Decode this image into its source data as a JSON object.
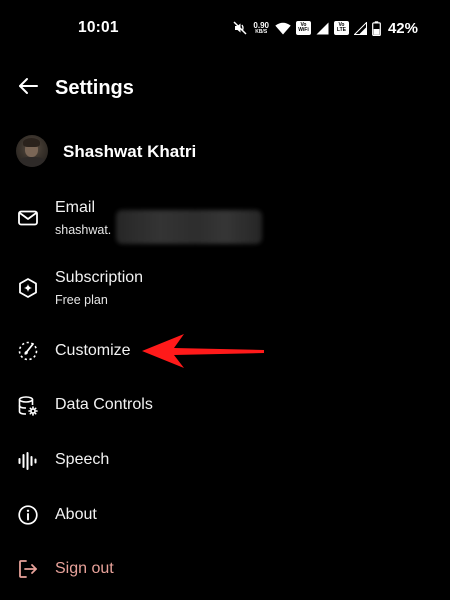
{
  "status_bar": {
    "time": "10:01",
    "net_speed_value": "0.90",
    "net_speed_unit": "KB/S",
    "sim1_top": "Vo",
    "sim1_bottom": "WiFi",
    "sim2_top": "Vo",
    "sim2_bottom": "LTE",
    "battery_percent": "42%"
  },
  "header": {
    "title": "Settings"
  },
  "profile": {
    "name": "Shashwat Khatri"
  },
  "settings": {
    "email": {
      "label": "Email",
      "value": "shashwat."
    },
    "subscription": {
      "label": "Subscription",
      "value": "Free plan"
    },
    "customize": {
      "label": "Customize"
    },
    "data_controls": {
      "label": "Data Controls"
    },
    "speech": {
      "label": "Speech"
    },
    "about": {
      "label": "About"
    },
    "sign_out": {
      "label": "Sign out"
    }
  },
  "colors": {
    "background": "#000000",
    "text": "#ffffff",
    "sign_out": "#e8a29a",
    "annotation_arrow": "#ff1a1a"
  }
}
